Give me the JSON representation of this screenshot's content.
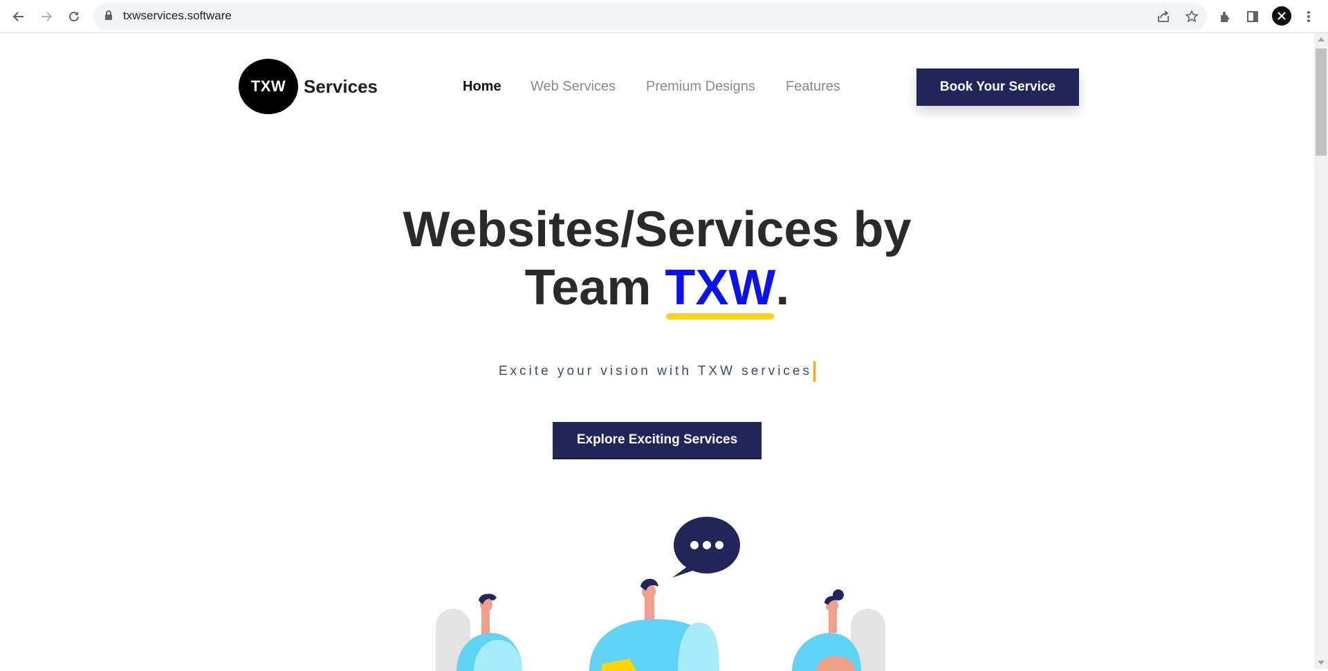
{
  "browser": {
    "url": "txwservices.software"
  },
  "header": {
    "logo_mark": "TXW",
    "logo_text": "Services",
    "nav": [
      {
        "label": "Home",
        "active": true
      },
      {
        "label": "Web Services",
        "active": false
      },
      {
        "label": "Premium Designs",
        "active": false
      },
      {
        "label": "Features",
        "active": false
      }
    ],
    "cta_label": "Book Your Service"
  },
  "hero": {
    "line1": "Websites/Services by",
    "line2_prefix": "Team ",
    "highlight": "TXW",
    "line2_suffix": ".",
    "subtitle": "Excite your vision with TXW services",
    "button_label": "Explore Exciting Services"
  },
  "colors": {
    "primary": "#22255a",
    "highlight": "#0a12ee",
    "underline": "#ffd600",
    "caret": "#f5a623"
  }
}
